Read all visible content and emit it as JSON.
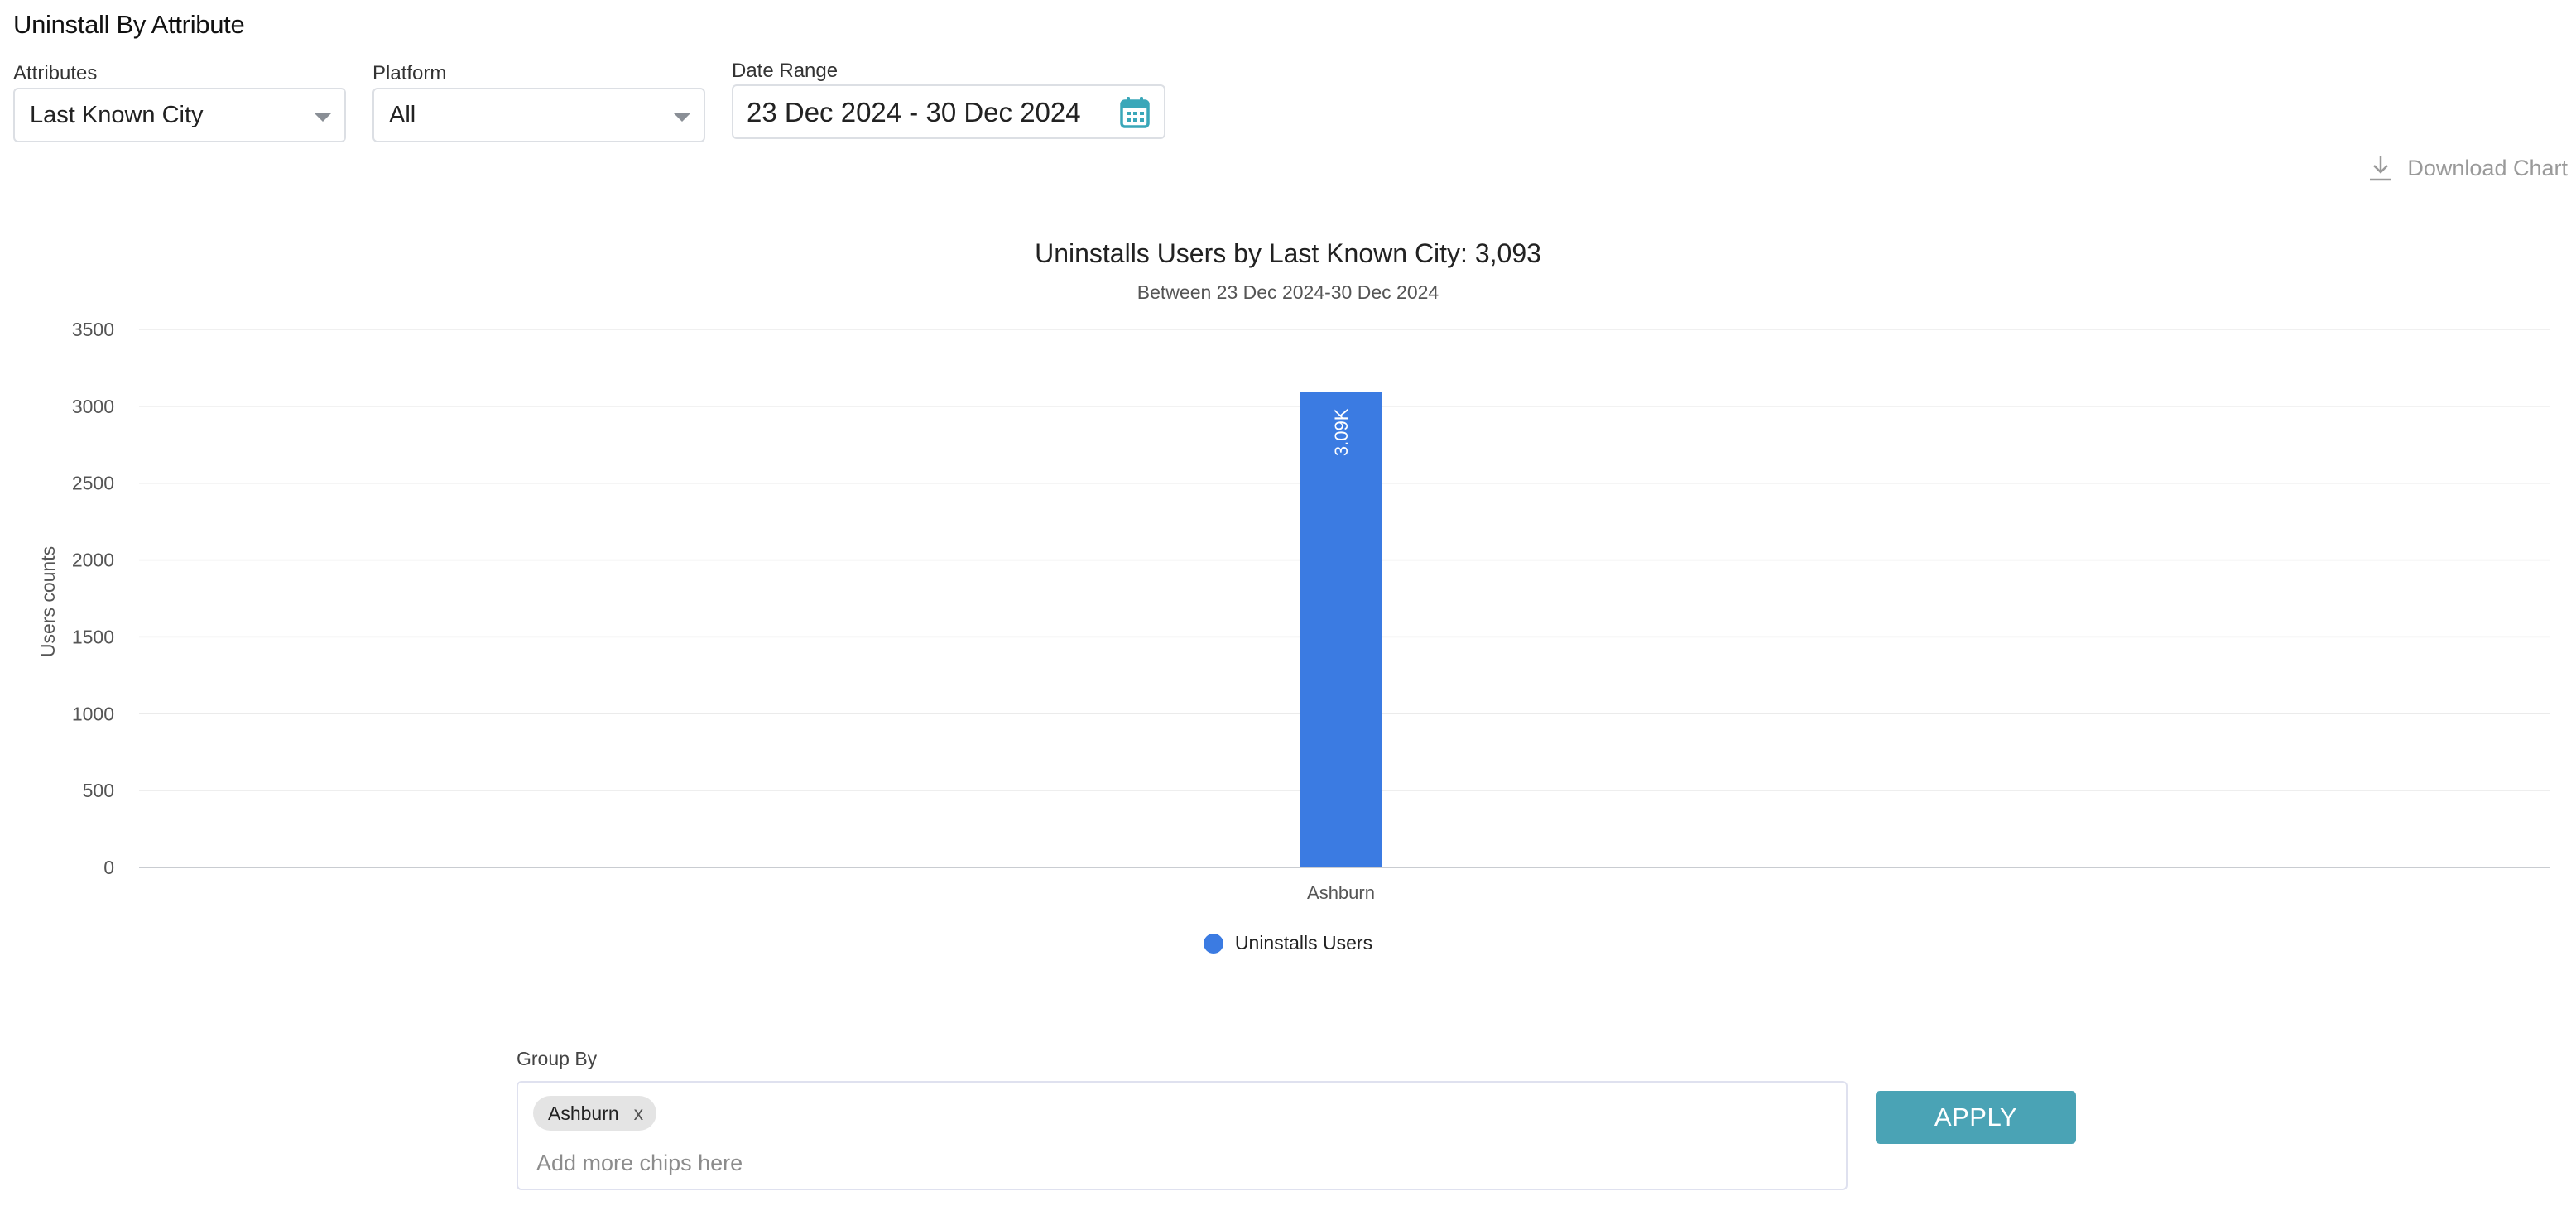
{
  "page": {
    "title": "Uninstall By Attribute"
  },
  "filters": {
    "attributes": {
      "label": "Attributes",
      "value": "Last Known City"
    },
    "platform": {
      "label": "Platform",
      "value": "All"
    },
    "date_range": {
      "label": "Date Range",
      "value": "23 Dec 2024 - 30 Dec 2024"
    }
  },
  "download": {
    "label": "Download Chart"
  },
  "colors": {
    "bar": "#3b7be2",
    "apply": "#4aa3b5",
    "calendar_icon": "#3aa7b9"
  },
  "chart_data": {
    "type": "bar",
    "title": "Uninstalls Users by Last Known City: 3,093",
    "subtitle": "Between 23 Dec 2024-30 Dec 2024",
    "xlabel": "",
    "ylabel": "Users counts",
    "ylim": [
      0,
      3500
    ],
    "yticks": [
      "0",
      "500",
      "1000",
      "1500",
      "2000",
      "2500",
      "3000",
      "3500"
    ],
    "categories": [
      "Ashburn"
    ],
    "series": [
      {
        "name": "Uninstalls Users",
        "values": [
          3093
        ],
        "data_labels": [
          "3.09K"
        ]
      }
    ],
    "grid": true,
    "legend": "bottom-center"
  },
  "group_by": {
    "label": "Group By",
    "chips": [
      {
        "label": "Ashburn",
        "remove": "x"
      }
    ],
    "placeholder": "Add more chips here"
  },
  "apply": {
    "label": "APPLY"
  }
}
